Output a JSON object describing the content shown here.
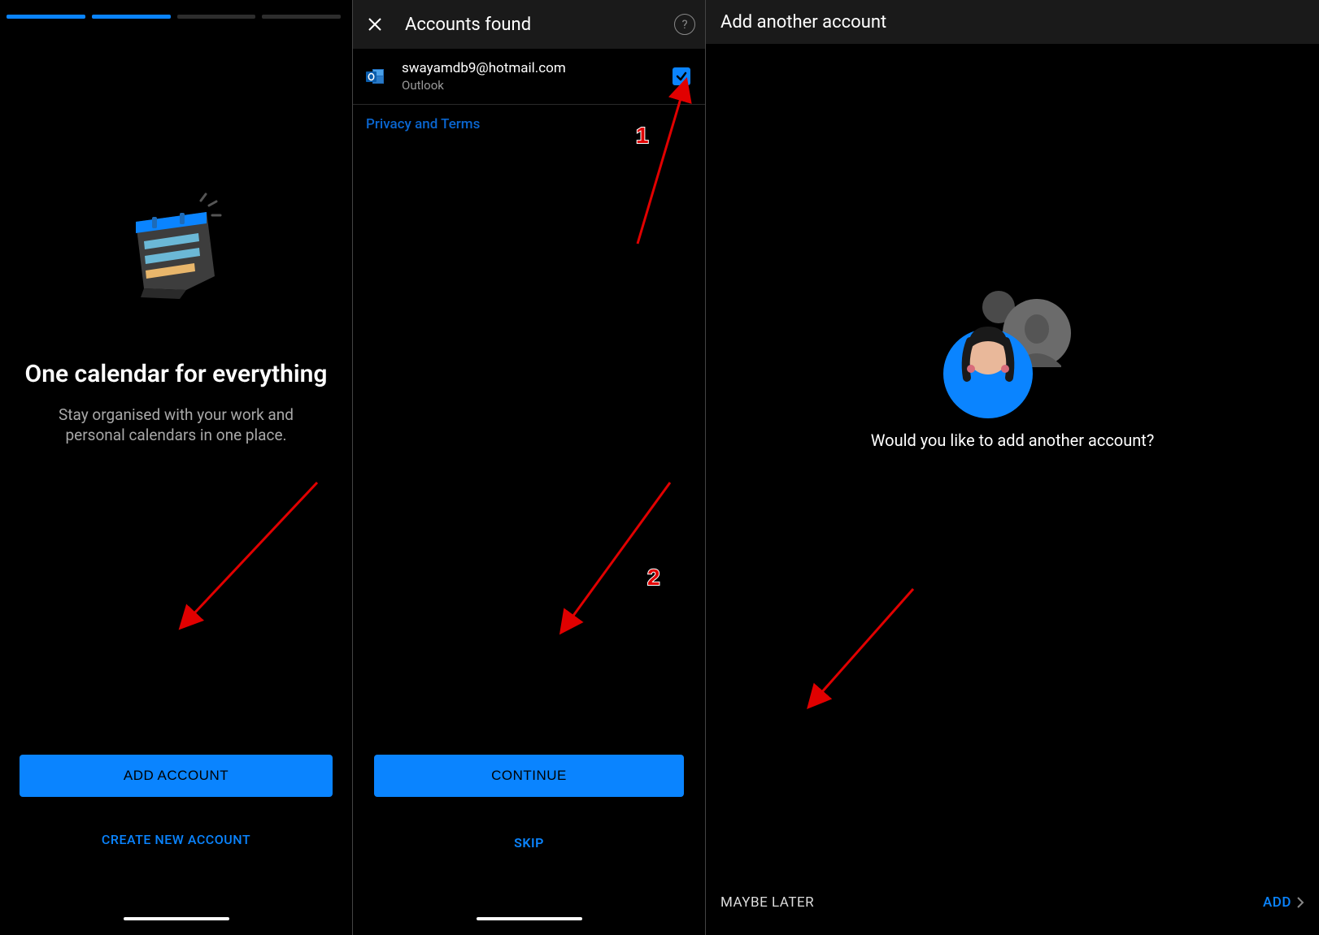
{
  "screen1": {
    "headline": "One calendar for everything",
    "sub": "Stay organised with your work and personal calendars in one place.",
    "primary_button": "ADD ACCOUNT",
    "secondary_button": "CREATE NEW ACCOUNT",
    "progress_total": 4,
    "progress_active": 2
  },
  "screen2": {
    "title": "Accounts found",
    "account_email": "swayamdb9@hotmail.com",
    "account_provider": "Outlook",
    "privacy_link": "Privacy and Terms",
    "primary_button": "CONTINUE",
    "skip_button": "SKIP",
    "account_checked": true
  },
  "screen3": {
    "title": "Add another account",
    "question": "Would you like to add another account?",
    "later_button": "MAYBE LATER",
    "add_button": "ADD"
  },
  "annotations": {
    "label_1": "1",
    "label_2": "2"
  },
  "colors": {
    "accent": "#0a84ff",
    "red": "#e10000"
  }
}
